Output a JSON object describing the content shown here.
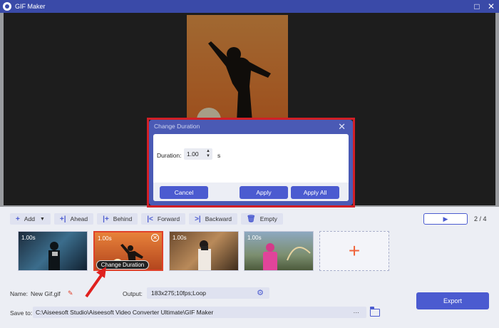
{
  "window": {
    "title": "GIF Maker"
  },
  "dialog": {
    "title": "Change Duration",
    "duration_label": "Duration:",
    "duration_value": "1.00",
    "unit": "s",
    "cancel_label": "Cancel",
    "apply_label": "Apply",
    "apply_all_label": "Apply All"
  },
  "toolbar": {
    "add": "Add",
    "ahead": "Ahead",
    "behind": "Behind",
    "forward": "Forward",
    "backward": "Backward",
    "empty": "Empty"
  },
  "pager": {
    "current": "2",
    "total": "4",
    "text": "2 / 4"
  },
  "clips": [
    {
      "duration": "1.00s"
    },
    {
      "duration": "1.00s",
      "selected": true
    },
    {
      "duration": "1.00s"
    },
    {
      "duration": "1.00s"
    }
  ],
  "change_duration_label": "Change Duration",
  "bottom": {
    "name_label": "Name:",
    "name_value": "New Gif.gif",
    "output_label": "Output:",
    "output_value": "183x275;10fps;Loop",
    "save_label": "Save to:",
    "save_path": "C:\\Aiseesoft Studio\\Aiseesoft Video Converter Ultimate\\GIF Maker",
    "more": "···",
    "export_label": "Export"
  },
  "colors": {
    "accent": "#4b5bd0",
    "highlight": "#d11f26",
    "titlebar": "#3a4aa8"
  }
}
